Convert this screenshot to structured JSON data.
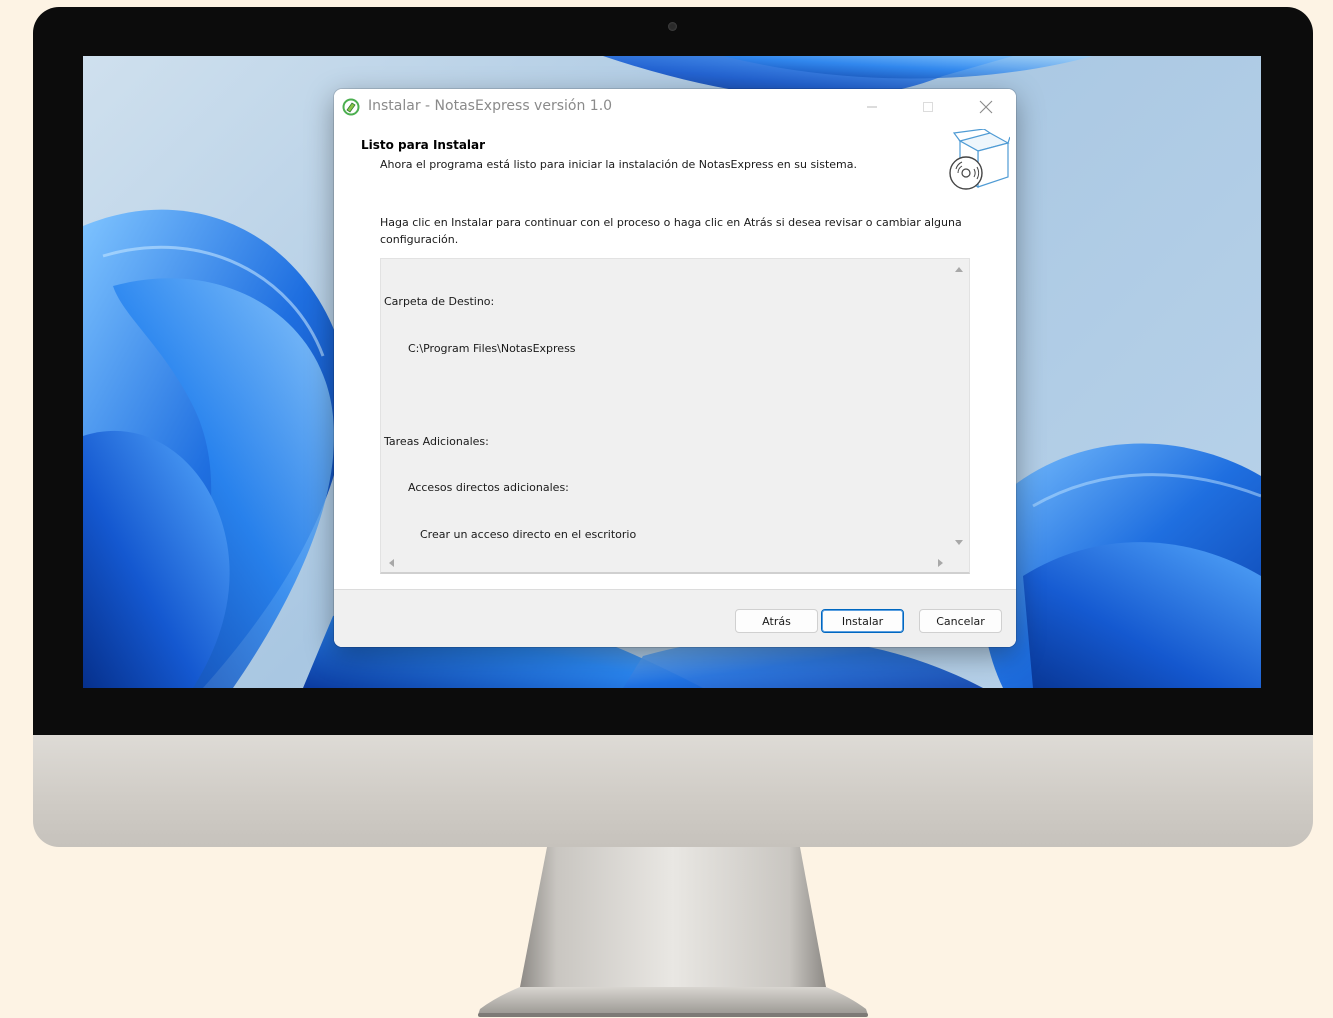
{
  "installer": {
    "window_title": "Instalar - NotasExpress versión 1.0",
    "page_title": "Listo para Instalar",
    "page_subtitle": "Ahora el programa está listo para iniciar la instalación de NotasExpress en su sistema.",
    "instruction": "Haga clic en Instalar para continuar con el proceso o haga clic en Atrás si desea revisar o cambiar alguna configuración.",
    "summary": {
      "dest_label": "Carpeta de Destino:",
      "dest_path": "C:\\Program Files\\NotasExpress",
      "tasks_label": "Tareas Adicionales:",
      "task_group": "Accesos directos adicionales:",
      "task_item": "Crear un acceso directo en el escritorio"
    },
    "buttons": {
      "back": "Atrás",
      "install": "Instalar",
      "cancel": "Cancelar"
    },
    "colors": {
      "accent": "#0067c0",
      "titlebar_text": "#8a8a8a",
      "wallpaper_blue": "#1f6fe0"
    }
  }
}
